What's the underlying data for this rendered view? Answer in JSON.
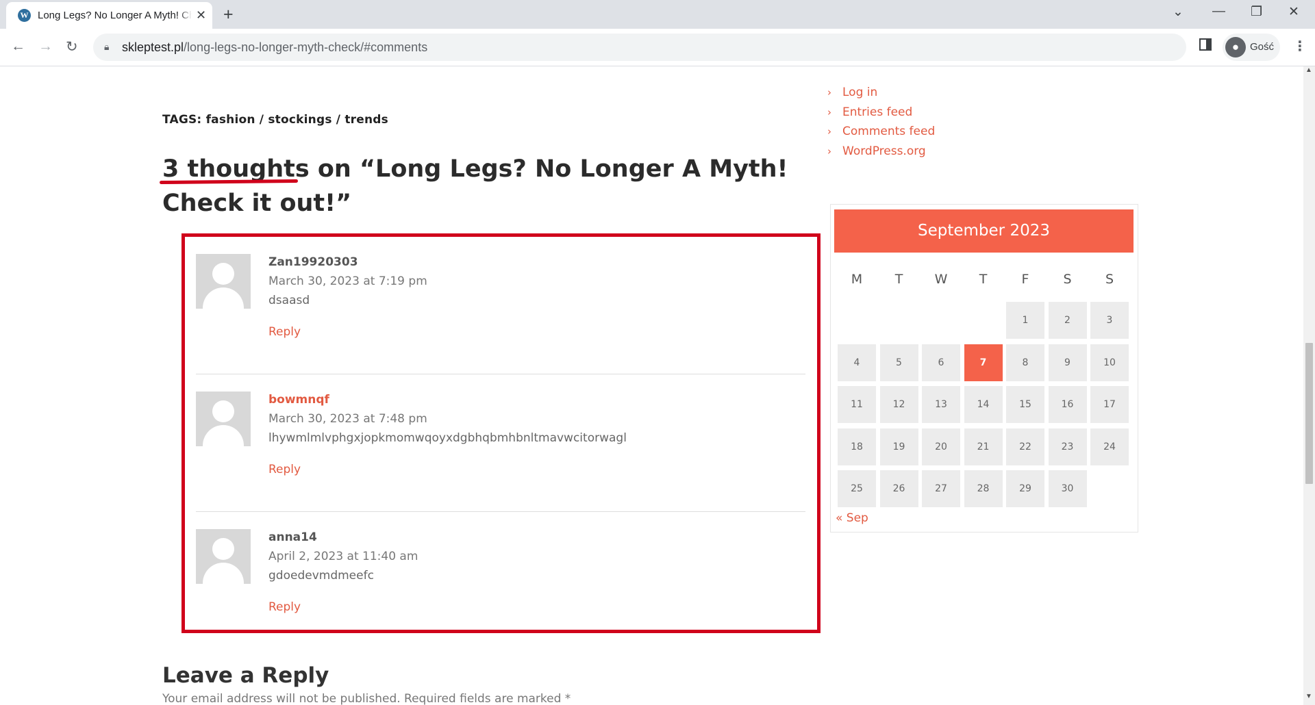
{
  "browser": {
    "tab_title": "Long Legs? No Longer A Myth! Check it out!",
    "favicon_letter": "W",
    "url_domain": "skleptest.pl",
    "url_path": "/long-legs-no-longer-myth-check/#comments",
    "profile_label": "Gość"
  },
  "post": {
    "tags_label": "TAGS:",
    "tags": [
      "fashion",
      "stockings",
      "trends"
    ],
    "tag_separator": "/",
    "comments_count_text": "3 thoughts",
    "comments_title_rest": " on “Long Legs? No Longer A Myth! Check it out!”"
  },
  "comments": [
    {
      "author": "Zan19920303",
      "date": "March 30, 2023 at 7:19 pm",
      "text": "dsaasd",
      "reply_label": "Reply"
    },
    {
      "author": "bowmnqf",
      "date": "March 30, 2023 at 7:48 pm",
      "text": "lhywmlmlvphgxjopkmomwqoyxdgbhqbmhbnltmavwcitorwagl",
      "reply_label": "Reply"
    },
    {
      "author": "anna14",
      "date": "April 2, 2023 at 11:40 am",
      "text": "gdoedevmdmeefc",
      "reply_label": "Reply"
    }
  ],
  "reply_form": {
    "title": "Leave a Reply",
    "note": "Your email address will not be published. Required fields are marked *"
  },
  "sidebar": {
    "meta_links": [
      "Log in",
      "Entries feed",
      "Comments feed",
      "WordPress.org"
    ],
    "calendar": {
      "month": "September 2023",
      "weekdays": [
        "M",
        "T",
        "W",
        "T",
        "F",
        "S",
        "S"
      ],
      "first_weekday_index": 4,
      "days_in_month": 30,
      "today": 7,
      "prev_link": "« Sep"
    }
  },
  "colors": {
    "accent": "#f4624a",
    "link": "#e25a41",
    "highlight": "#d0021b"
  }
}
